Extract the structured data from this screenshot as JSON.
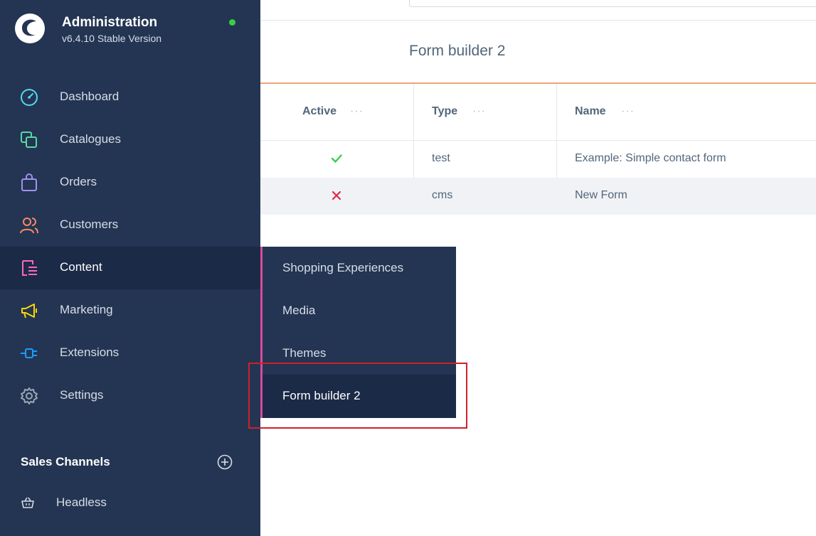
{
  "brand": {
    "title": "Administration",
    "version": "v6.4.10 Stable Version",
    "status_color": "#37d046"
  },
  "nav": {
    "items": [
      {
        "label": "Dashboard",
        "icon": "dashboard-icon",
        "color": "#57d9f0"
      },
      {
        "label": "Catalogues",
        "icon": "catalogues-icon",
        "color": "#57d9a3"
      },
      {
        "label": "Orders",
        "icon": "shopping-bag-icon",
        "color": "#a092f0"
      },
      {
        "label": "Customers",
        "icon": "customers-icon",
        "color": "#f88962"
      },
      {
        "label": "Content",
        "icon": "content-icon",
        "color": "#ff68b4",
        "active": true
      },
      {
        "label": "Marketing",
        "icon": "megaphone-icon",
        "color": "#ffd700"
      },
      {
        "label": "Extensions",
        "icon": "plug-icon",
        "color": "#189eff"
      },
      {
        "label": "Settings",
        "icon": "gear-icon",
        "color": "#9aa8b5"
      }
    ]
  },
  "sales_channels": {
    "title": "Sales Channels",
    "items": [
      {
        "label": "Headless",
        "icon": "basket-icon"
      }
    ]
  },
  "main": {
    "title": "Form builder 2",
    "columns": [
      "Active",
      "Type",
      "Name"
    ],
    "rows": [
      {
        "active": true,
        "type": "test",
        "name": "Example: Simple contact form"
      },
      {
        "active": false,
        "type": "cms",
        "name": "New Form"
      }
    ]
  },
  "flyout": {
    "items": [
      "Shopping Experiences",
      "Media",
      "Themes",
      "Form builder 2"
    ],
    "active_index": 3
  },
  "colors": {
    "sidebar_bg": "#243553",
    "accent": "#f0a37b",
    "highlight": "#d0202a",
    "check": "#37d046",
    "cross": "#de294c"
  }
}
